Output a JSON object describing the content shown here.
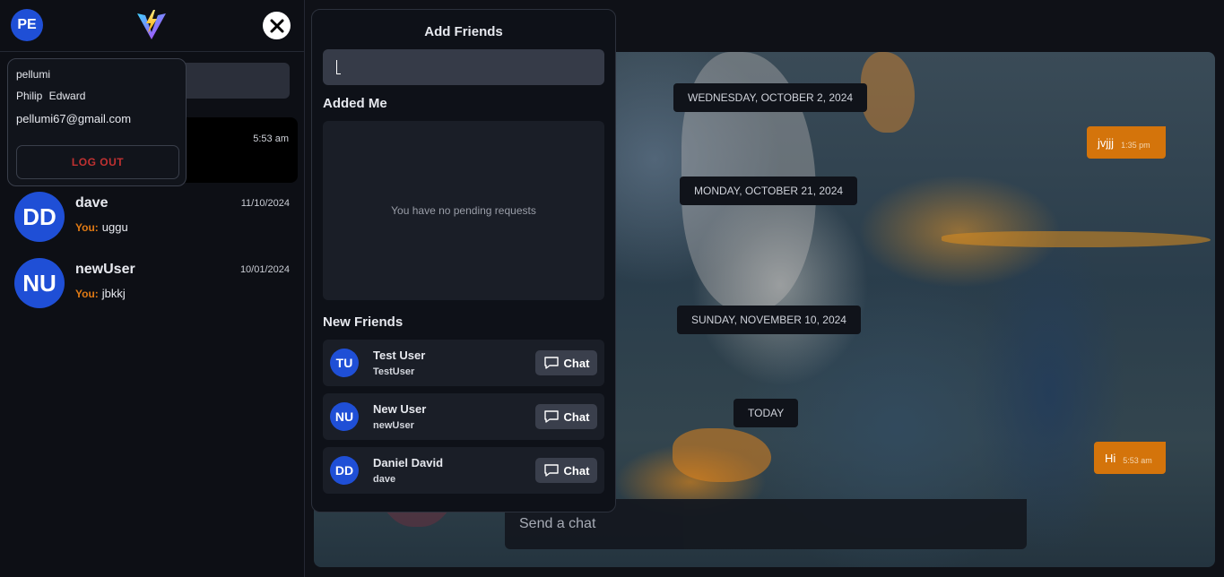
{
  "sidebar": {
    "avatar_initials": "PE",
    "chats": [
      {
        "initials": "",
        "name": "",
        "time": "5:53 am",
        "you": "",
        "last": ""
      },
      {
        "initials": "DD",
        "name": "dave",
        "time": "11/10/2024",
        "you": "You:",
        "last": "uggu"
      },
      {
        "initials": "NU",
        "name": "newUser",
        "time": "10/01/2024",
        "you": "You:",
        "last": "jbkkj"
      }
    ]
  },
  "profile": {
    "username": "pellumi",
    "full_name": "Philip Edward",
    "email": "pellumi67@gmail.com",
    "logout_label": "LOG OUT"
  },
  "add_friends": {
    "title": "Add Friends",
    "search_value": "",
    "added_me_heading": "Added Me",
    "pending_empty": "You have no pending requests",
    "new_friends_heading": "New Friends",
    "friends": [
      {
        "initials": "TU",
        "name": "Test User",
        "username": "TestUser",
        "chat_label": "Chat"
      },
      {
        "initials": "NU",
        "name": "New User",
        "username": "newUser",
        "chat_label": "Chat"
      },
      {
        "initials": "DD",
        "name": "Daniel David",
        "username": "dave",
        "chat_label": "Chat"
      }
    ]
  },
  "conversation": {
    "dates": [
      "WEDNESDAY, OCTOBER 2, 2024",
      "MONDAY, OCTOBER 21, 2024",
      "SUNDAY, NOVEMBER 10, 2024",
      "TODAY"
    ],
    "messages": [
      {
        "text": "jvjjj",
        "time": "1:35 pm"
      },
      {
        "text": "Hi",
        "time": "5:53 am"
      }
    ],
    "input_placeholder": "Send a chat"
  },
  "colors": {
    "accent": "#d4740b",
    "avatar": "#1f4fd6",
    "logout": "#c03131"
  }
}
